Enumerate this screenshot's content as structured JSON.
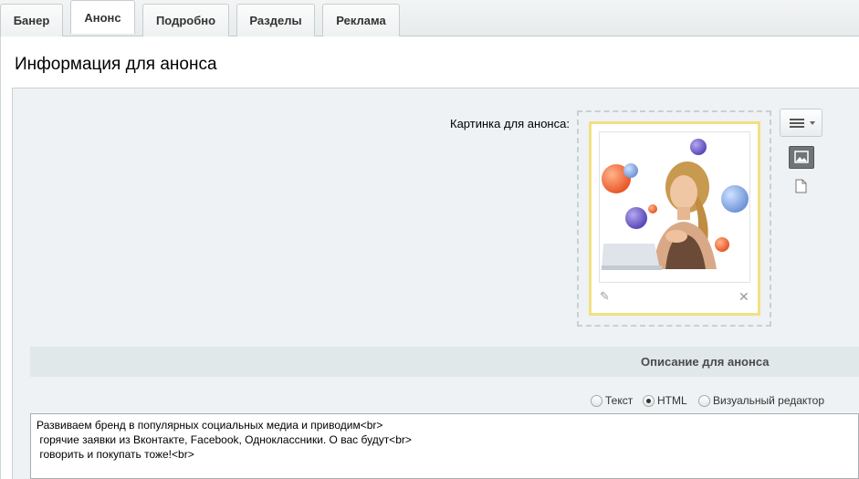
{
  "tabs": [
    {
      "label": "Банер",
      "active": false
    },
    {
      "label": "Анонс",
      "active": true
    },
    {
      "label": "Подробно",
      "active": false
    },
    {
      "label": "Разделы",
      "active": false
    },
    {
      "label": "Реклама",
      "active": false
    }
  ],
  "page_title": "Информация для анонса",
  "image_field": {
    "label": "Картинка для анонса:",
    "icons": [
      "pencil-icon",
      "close-icon",
      "menu-icon",
      "image-icon",
      "file-icon"
    ]
  },
  "description": {
    "header": "Описание для анонса",
    "modes": [
      {
        "label": "Текст",
        "checked": false
      },
      {
        "label": "HTML",
        "checked": true
      },
      {
        "label": "Визуальный редактор",
        "checked": false
      }
    ],
    "text": "Развиваем бренд в популярных социальных медиа и приводим<br>\n горячие заявки из Вконтакте, Facebook, Одноклассники. О вас будут<br>\n говорить и покупать тоже!<br>"
  },
  "colors": {
    "frame_highlight": "#f3df84",
    "section_header_bg": "#e0e8ea",
    "panel_bg": "#eef2f4"
  }
}
